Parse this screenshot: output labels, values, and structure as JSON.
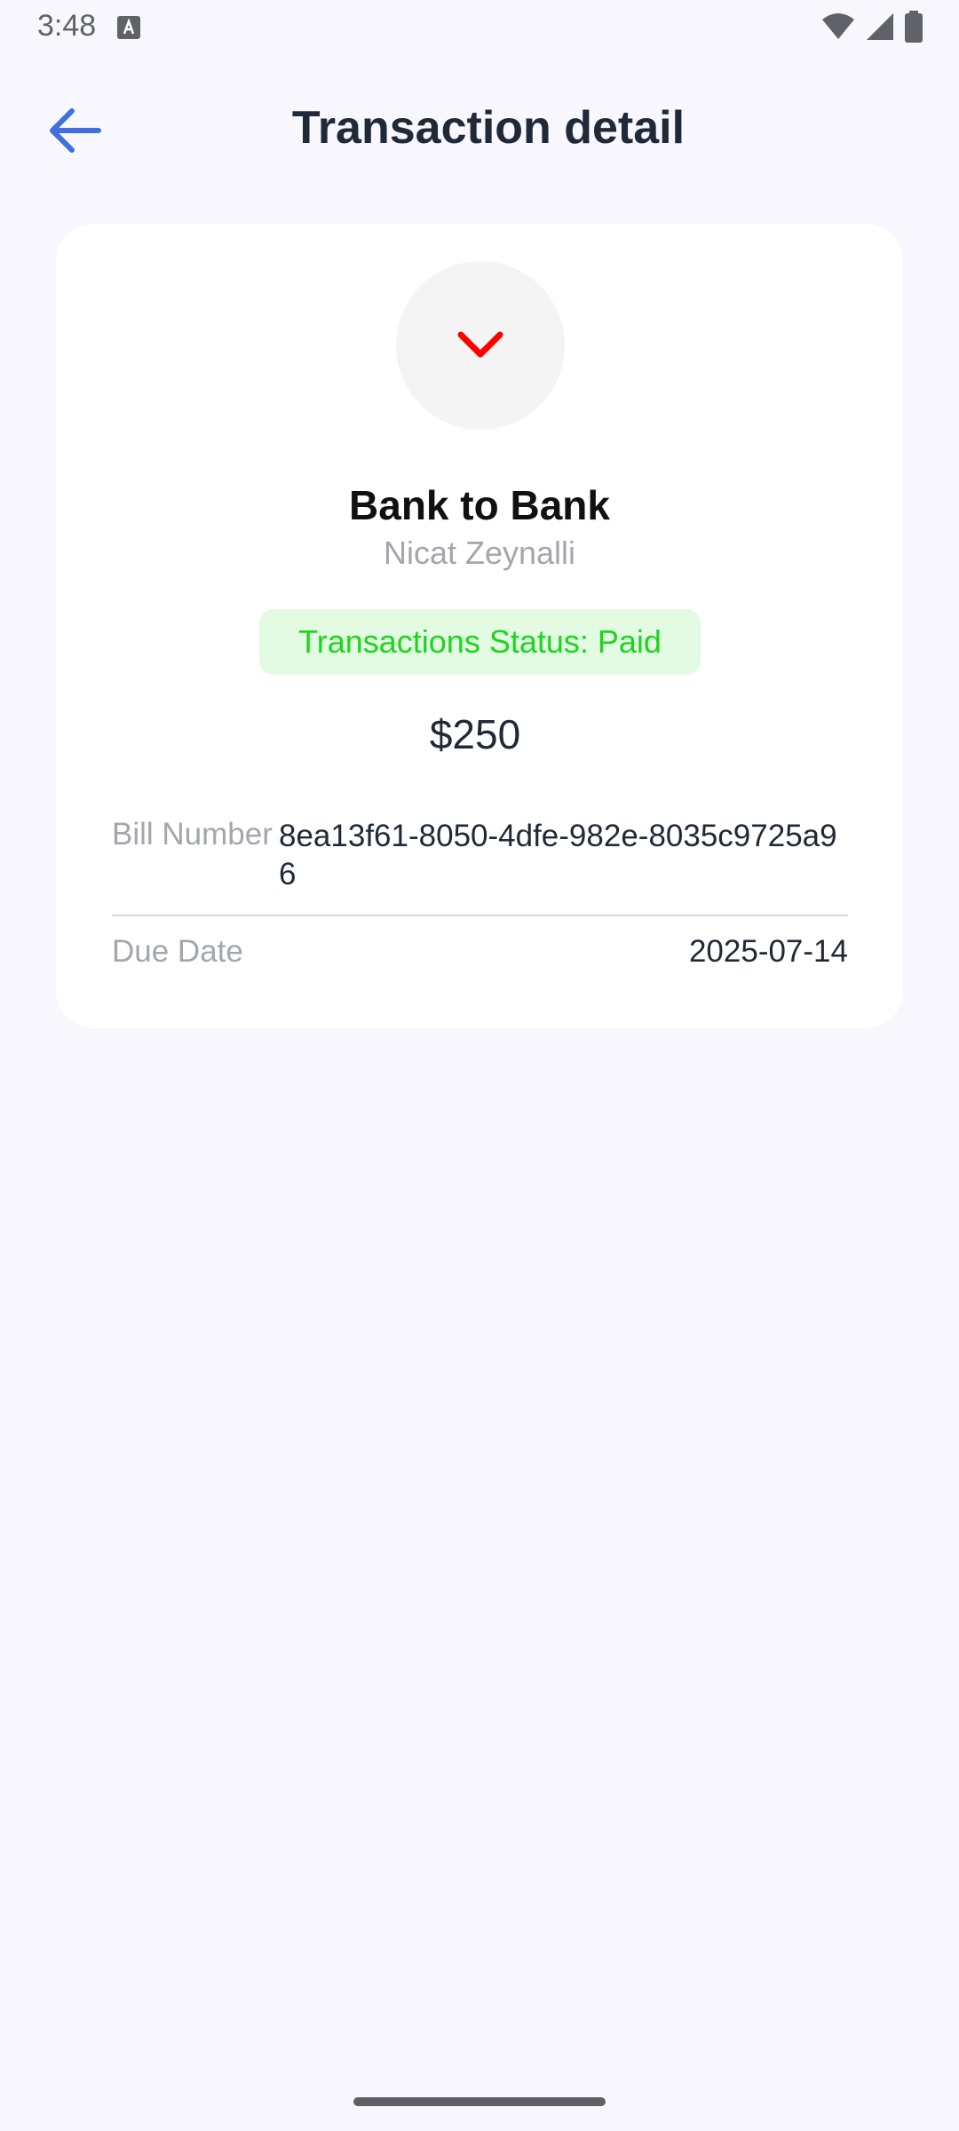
{
  "status_bar": {
    "time": "3:48",
    "icons": [
      "text-a-icon",
      "wifi-icon",
      "signal-icon",
      "battery-icon"
    ]
  },
  "header": {
    "back_icon": "arrow-left-icon",
    "title": "Transaction detail"
  },
  "transaction": {
    "direction_icon": "chevron-down-icon",
    "title": "Bank to Bank",
    "subtitle": "Nicat Zeynalli",
    "status_text": "Transactions Status: Paid",
    "amount": "$250",
    "bill_number_label": "Bill Number",
    "bill_number_value": "8ea13f61-8050-4dfe-982e-8035c9725a96",
    "due_date_label": "Due Date",
    "due_date_value": "2025-07-14"
  },
  "colors": {
    "background": "#f7f7fd",
    "accent": "#3f6fe0",
    "status_green": "#1fd41f",
    "status_bg": "#e2fbe2",
    "direction_red": "#ff0000"
  }
}
